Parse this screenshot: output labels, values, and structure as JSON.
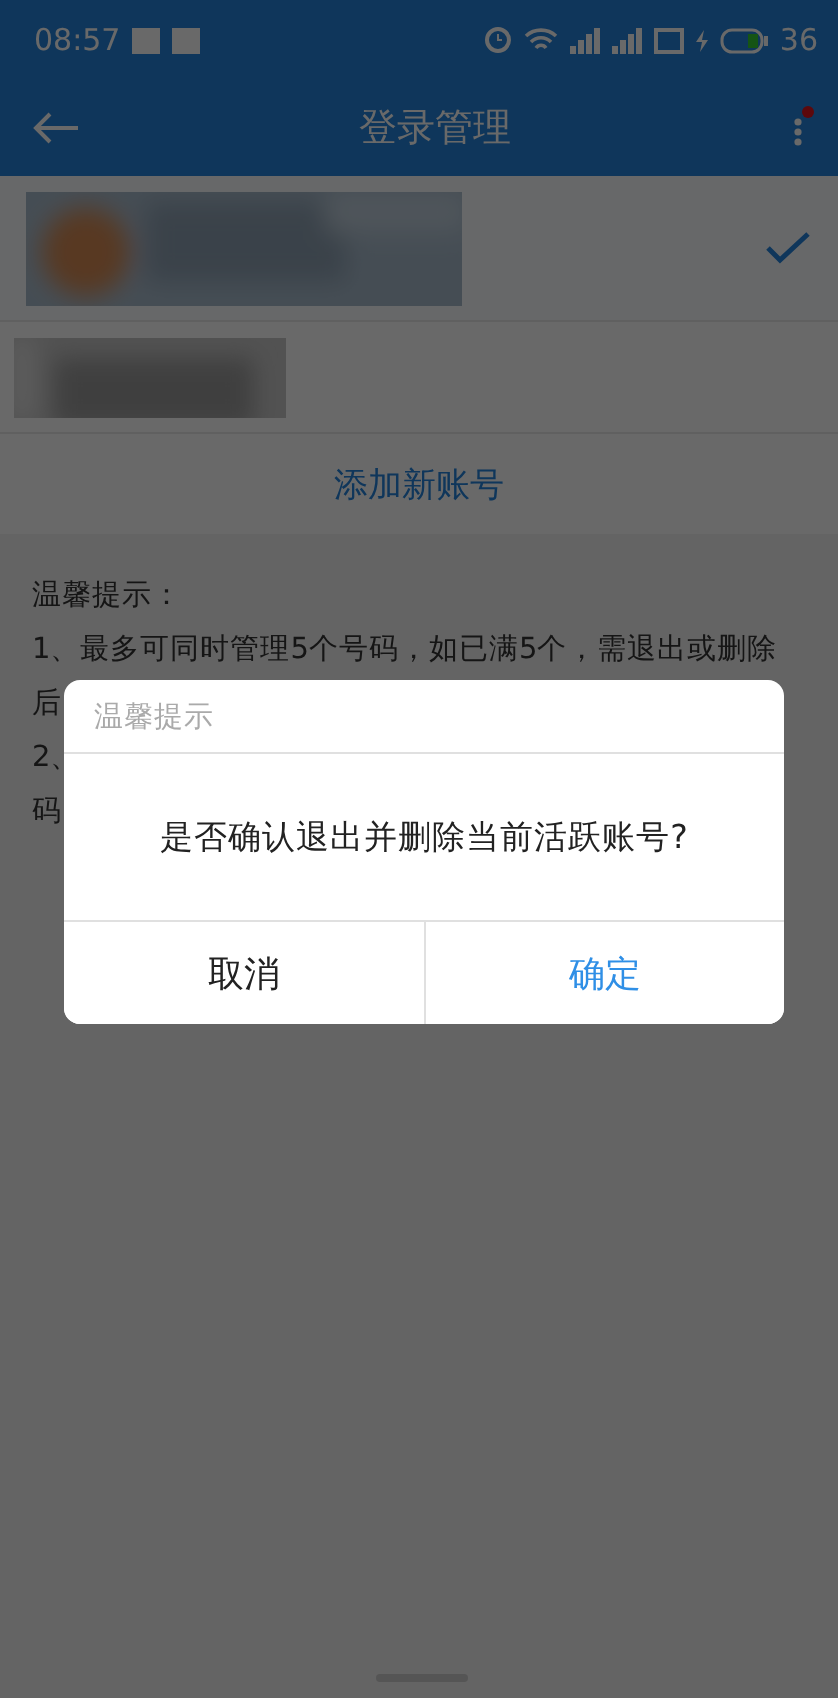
{
  "status_bar": {
    "time": "08:57",
    "battery": "36"
  },
  "header": {
    "title": "登录管理",
    "notification_dot": true
  },
  "accounts": [
    {
      "kind": "picture",
      "selected": true
    },
    {
      "kind": "picture",
      "selected": false
    }
  ],
  "add_account": "添加新账号",
  "tips": {
    "title": "温馨提示：",
    "lines": [
      "1、最多可同时管理5个号码，如已满5个，需退出或删除",
      "后",
      "2、",
      "码"
    ]
  },
  "dialog": {
    "title": "温馨提示",
    "message": "是否确认退出并删除当前活跃账号?",
    "buttons": [
      {
        "label": "取消",
        "kind": "cancel"
      },
      {
        "label": "确定",
        "kind": "confirm"
      }
    ]
  }
}
